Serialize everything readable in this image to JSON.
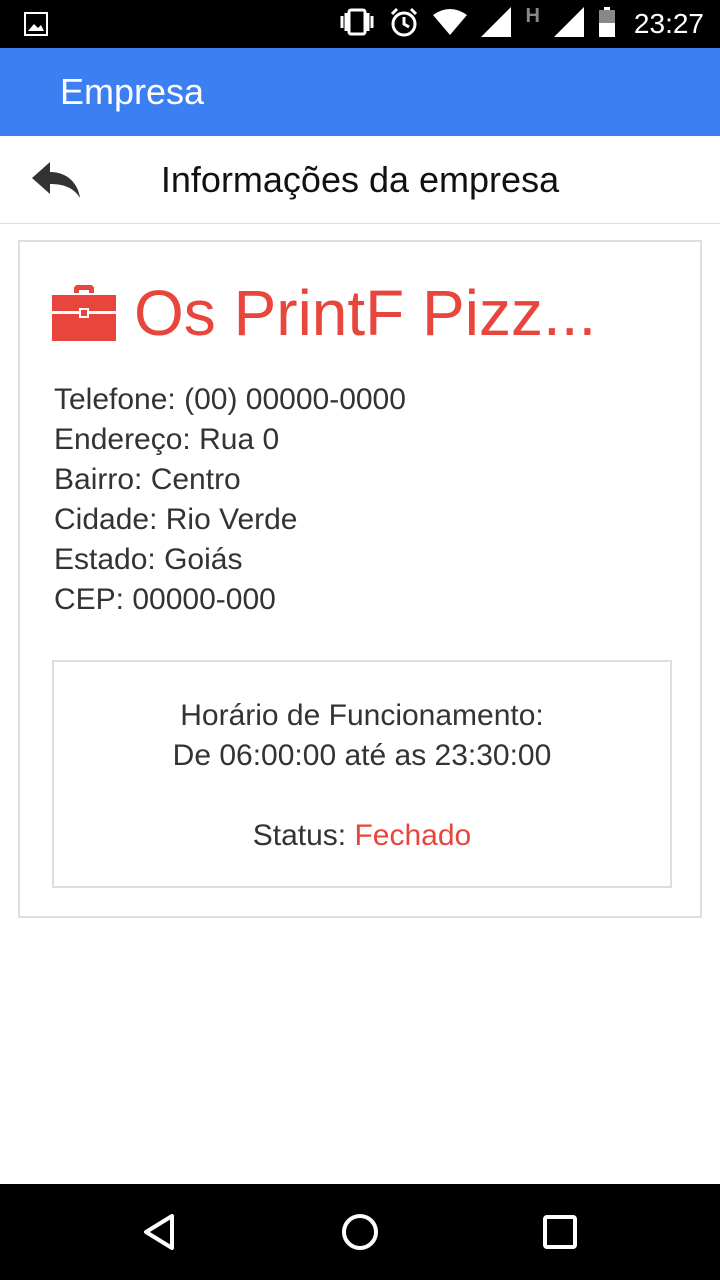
{
  "status_bar": {
    "time": "23:27",
    "network_letter": "H",
    "icons": [
      "image-icon",
      "vibrate-icon",
      "alarm-icon",
      "wifi-icon",
      "signal-icon",
      "signal-icon",
      "battery-icon"
    ]
  },
  "app_bar": {
    "title": "Empresa",
    "color": "#3b7ff2"
  },
  "sub_header": {
    "title": "Informações da empresa",
    "back_icon": "reply-arrow-icon"
  },
  "company": {
    "icon": "briefcase-icon",
    "name": "Os PrintF Pizz...",
    "accent_color": "#e8453c",
    "details": [
      "Telefone: (00) 00000-0000",
      "Endereço: Rua 0",
      "Bairro: Centro",
      "Cidade: Rio Verde",
      "Estado: Goiás",
      "CEP: 00000-000"
    ]
  },
  "hours": {
    "label": "Horário de Funcionamento:",
    "value": "De 06:00:00 até as 23:30:00",
    "status_label": "Status:",
    "status_value": "Fechado"
  },
  "nav_bar": {
    "icons": [
      "back-triangle-icon",
      "home-circle-icon",
      "recents-square-icon"
    ]
  }
}
